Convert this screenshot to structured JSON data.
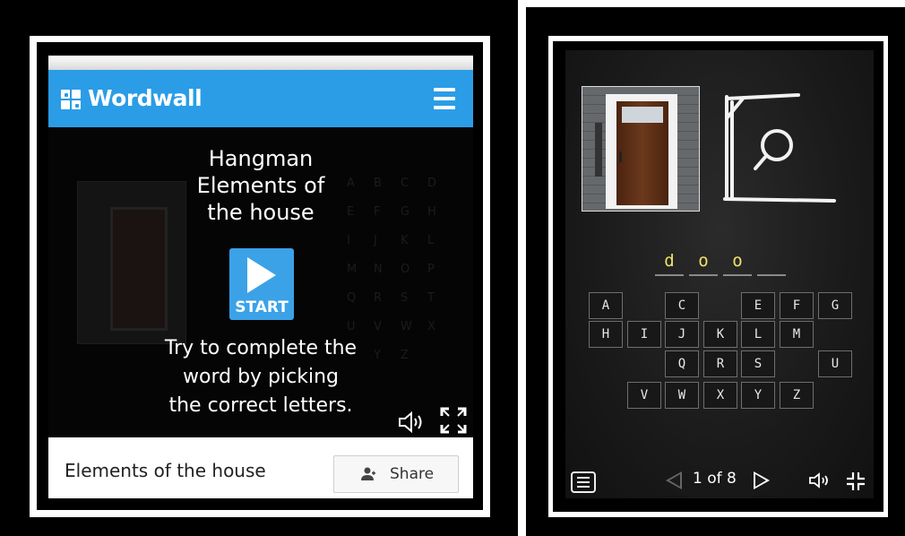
{
  "left": {
    "brand": "Wordwall",
    "game_title_lines": [
      "Hangman",
      "Elements of",
      "the house"
    ],
    "start_label": "START",
    "instructions_lines": [
      "Try to complete the",
      "word by picking",
      "the correct letters."
    ],
    "footer_title": "Elements of the house",
    "share_label": "Share",
    "colors": {
      "header": "#2a9de6",
      "start_button": "#3ba2e8"
    },
    "icons": [
      "wordwall-logo-icon",
      "hamburger-menu-icon",
      "play-icon",
      "speaker-icon",
      "fullscreen-icon",
      "share-person-icon"
    ]
  },
  "right": {
    "word_slots": [
      "d",
      "o",
      "o",
      ""
    ],
    "letter_keys": [
      [
        "A",
        "C",
        "E",
        "F",
        "G"
      ],
      [
        "H",
        "I",
        "J",
        "K",
        "L",
        "M"
      ],
      [
        "Q",
        "R",
        "S",
        "U"
      ],
      [
        "V",
        "W",
        "X",
        "Y",
        "Z"
      ]
    ],
    "page_counter": "1 of 8",
    "colors": {
      "chalk_letter": "#f0e36a"
    },
    "icons": [
      "door-photo",
      "hangman-gallows-icon",
      "menu-icon",
      "prev-arrow-icon",
      "next-arrow-icon",
      "speaker-icon",
      "exit-fullscreen-icon"
    ]
  }
}
